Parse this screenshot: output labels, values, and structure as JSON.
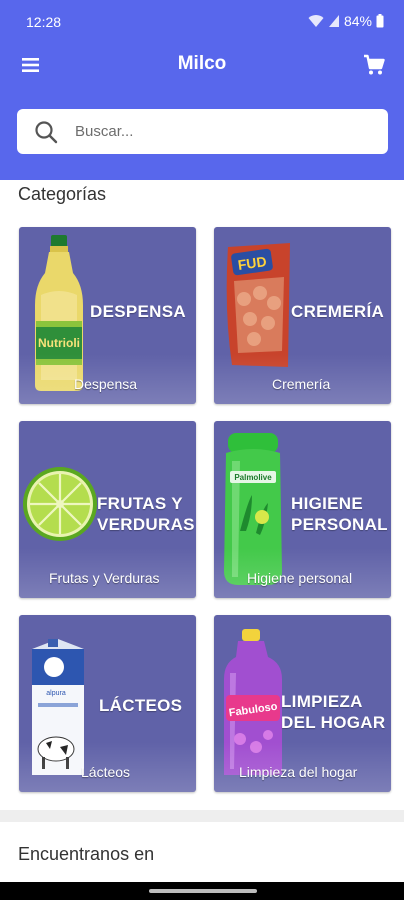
{
  "status_bar": {
    "time": "12:28",
    "battery": "84%"
  },
  "app_bar": {
    "title": "Milco"
  },
  "search": {
    "placeholder": "Buscar..."
  },
  "categories": {
    "heading": "Categorías",
    "items": [
      {
        "title_line1": "DESPENSA",
        "title_line2": "",
        "label": "Despensa",
        "image": "nutrioli-oil-bottle"
      },
      {
        "title_line1": "CREMERÍA",
        "title_line2": "",
        "label": "Cremería",
        "image": "fud-sausage-pack"
      },
      {
        "title_line1": "FRUTAS Y",
        "title_line2": "VERDURAS",
        "label": "Frutas y Verduras",
        "image": "lime-slice"
      },
      {
        "title_line1": "HIGIENE",
        "title_line2": "PERSONAL",
        "label": "Higiene personal",
        "image": "palmolive-shampoo-bottle"
      },
      {
        "title_line1": "LÁCTEOS",
        "title_line2": "",
        "label": "Lácteos",
        "image": "milk-carton"
      },
      {
        "title_line1": "LIMPIEZA",
        "title_line2": "DEL HOGAR",
        "label": "Limpieza del hogar",
        "image": "fabuloso-cleaner-bottle"
      }
    ]
  },
  "footer": {
    "heading": "Encuentranos en"
  },
  "colors": {
    "header": "#5867ec",
    "card": "#6062a8"
  }
}
